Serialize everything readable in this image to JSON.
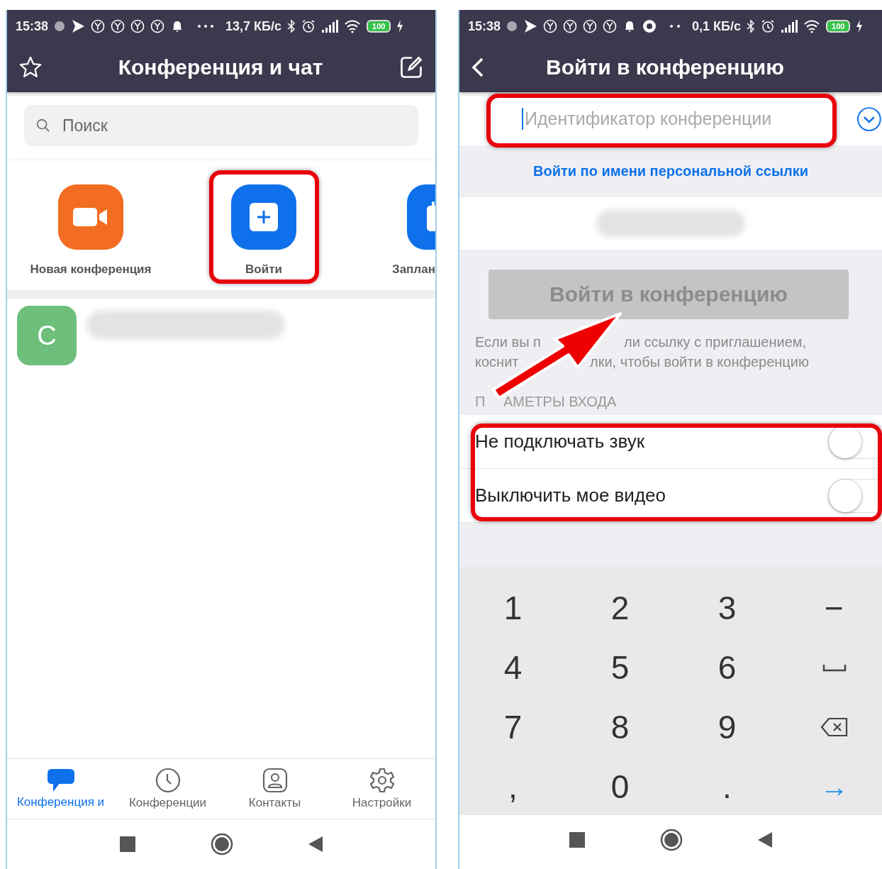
{
  "left_screen": {
    "status_bar": {
      "time": "15:38",
      "speed": "13,7 КБ/с",
      "battery": "100"
    },
    "header": {
      "title": "Конференция и чат"
    },
    "search": {
      "placeholder": "Поиск"
    },
    "actions": [
      {
        "label": "Новая конференция",
        "color": "#f26d21",
        "kind": "video"
      },
      {
        "label": "Войти",
        "color": "#0e71eb",
        "kind": "plus"
      },
      {
        "label": "Заплан",
        "color": "#0e71eb",
        "kind": "calendar"
      }
    ],
    "chats": [
      {
        "initial": "C"
      }
    ],
    "tabs": [
      {
        "label": "Конференция и",
        "selected": true,
        "kind": "chat"
      },
      {
        "label": "Конференции",
        "selected": false,
        "kind": "clock"
      },
      {
        "label": "Контакты",
        "selected": false,
        "kind": "contact"
      },
      {
        "label": "Настройки",
        "selected": false,
        "kind": "gear"
      }
    ]
  },
  "right_screen": {
    "status_bar": {
      "time": "15:38",
      "speed": "0,1 КБ/с",
      "battery": "100"
    },
    "header": {
      "title": "Войти в конференцию"
    },
    "meeting_id": {
      "placeholder": "Идентификатор конференции"
    },
    "link": "Войти по имени персональной ссылки",
    "join_button": {
      "label": "Войти в конференцию",
      "disabled": true
    },
    "hint_lines": [
      [
        "Если вы п",
        "ли ссылку с приглашением,"
      ],
      [
        "коснит",
        "лки, чтобы войти в конференцию"
      ]
    ],
    "section_parts": [
      "П",
      "АМЕТРЫ ВХОДА"
    ],
    "options": [
      {
        "label": "Не подключать звук",
        "on": false
      },
      {
        "label": "Выключить мое видео",
        "on": false
      }
    ],
    "keypad": [
      {
        "label": "1",
        "kind": "char"
      },
      {
        "label": "2",
        "kind": "char"
      },
      {
        "label": "3",
        "kind": "char"
      },
      {
        "label": "−",
        "kind": "char"
      },
      {
        "label": "4",
        "kind": "char"
      },
      {
        "label": "5",
        "kind": "char"
      },
      {
        "label": "6",
        "kind": "char"
      },
      {
        "kind": "space"
      },
      {
        "label": "7",
        "kind": "char"
      },
      {
        "label": "8",
        "kind": "char"
      },
      {
        "label": "9",
        "kind": "char"
      },
      {
        "kind": "backspace"
      },
      {
        "label": ",",
        "kind": "char"
      },
      {
        "label": "0",
        "kind": "char"
      },
      {
        "label": ".",
        "kind": "char"
      },
      {
        "label": "→",
        "kind": "enter"
      }
    ]
  }
}
